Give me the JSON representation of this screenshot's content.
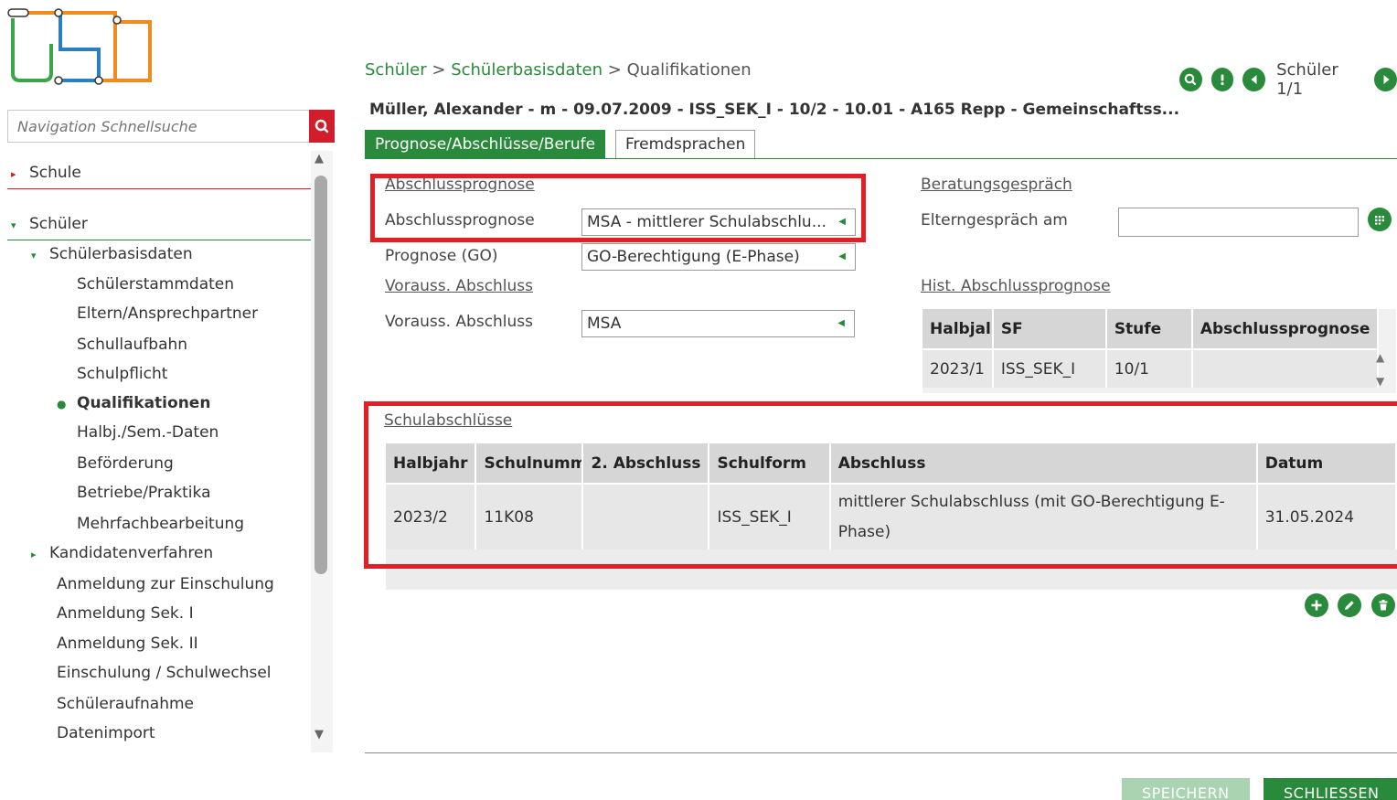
{
  "search": {
    "placeholder": "Navigation Schnellsuche"
  },
  "nav": {
    "schule": "Schule",
    "schueler": "Schüler",
    "schuelerbasisdaten": "Schülerbasisdaten",
    "items": [
      "Schülerstammdaten",
      "Eltern/Ansprechpartner",
      "Schullaufbahn",
      "Schulpflicht",
      "Qualifikationen",
      "Halbj./Sem.-Daten",
      "Beförderung",
      "Betriebe/Praktika",
      "Mehrfachbearbeitung"
    ],
    "kandidaten": "Kandidatenverfahren",
    "other": [
      "Anmeldung zur Einschulung",
      "Anmeldung Sek. I",
      "Anmeldung Sek. II",
      "Einschulung / Schulwechsel",
      "Schüleraufnahme",
      "Datenimport"
    ]
  },
  "breadcrumb": {
    "level1": "Schüler",
    "level2": "Schülerbasisdaten",
    "current": "Qualifikationen",
    "sep": ">"
  },
  "pager": {
    "label": "Schüler 1/1"
  },
  "student_header": "Müller, Alexander - m - 09.07.2009 - ISS_SEK_I - 10/2 - 10.01 - A165 Repp - Gemeinschaftss...",
  "tabs": [
    "Prognose/Abschlüsse/Berufe",
    "Fremdsprachen"
  ],
  "prognose": {
    "section": "Abschlussprognose",
    "label1": "Abschlussprognose",
    "value1": "MSA - mittlerer Schulabschlu...",
    "label2": "Prognose (GO)",
    "value2": "GO-Berechtigung (E-Phase)",
    "section2": "Vorauss. Abschluss",
    "label3": "Vorauss. Abschluss",
    "value3": "MSA"
  },
  "beratung": {
    "section": "Beratungsgespräch",
    "label": "Elterngespräch am",
    "value": ""
  },
  "hist": {
    "section": "Hist. Abschlussprognose",
    "headers": [
      "Halbjal",
      "SF",
      "Stufe",
      "Abschlussprognose"
    ],
    "rows": [
      [
        "2023/1",
        "ISS_SEK_I",
        "10/1",
        ""
      ]
    ]
  },
  "schulabschluesse": {
    "section": "Schulabschlüsse",
    "headers": [
      "Halbjahr",
      "Schulnumme",
      "2. Abschluss",
      "Schulform",
      "Abschluss",
      "Datum"
    ],
    "rows": [
      [
        "2023/2",
        "11K08",
        "",
        "ISS_SEK_I",
        "mittlerer Schulabschluss (mit GO-Berechtigung E-Phase)",
        "31.05.2024"
      ]
    ]
  },
  "buttons": {
    "save": "SPEICHERN",
    "close": "SCHLIESSEN"
  },
  "colors": {
    "accent": "#2a8a3c",
    "highlight": "#e11f26",
    "search_button": "#d21e2b"
  }
}
